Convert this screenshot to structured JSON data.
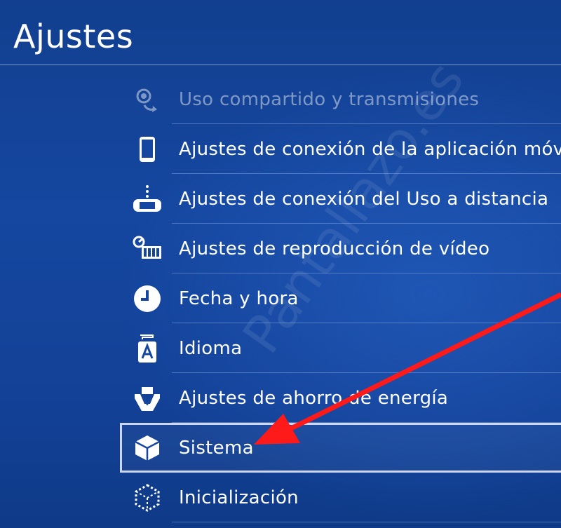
{
  "page": {
    "title": "Ajustes"
  },
  "menu": {
    "items": [
      {
        "label": "Uso compartido y transmisiones",
        "icon": "share-stream-icon"
      },
      {
        "label": "Ajustes de conexión de la aplicación móvil",
        "icon": "smartphone-icon"
      },
      {
        "label": "Ajustes de conexión del Uso a distancia",
        "icon": "remote-play-icon"
      },
      {
        "label": "Ajustes de reproducción de vídeo",
        "icon": "video-playback-icon"
      },
      {
        "label": "Fecha y hora",
        "icon": "clock-icon"
      },
      {
        "label": "Idioma",
        "icon": "language-icon"
      },
      {
        "label": "Ajustes de ahorro de energía",
        "icon": "power-save-icon"
      },
      {
        "label": "Sistema",
        "icon": "system-cube-icon",
        "selected": true
      },
      {
        "label": "Inicialización",
        "icon": "initialization-icon"
      }
    ]
  },
  "watermark": {
    "text": "Pantallazo.es"
  },
  "colors": {
    "background": "#1547a0",
    "arrow": "#ff1a1a",
    "text": "#ffffff"
  }
}
